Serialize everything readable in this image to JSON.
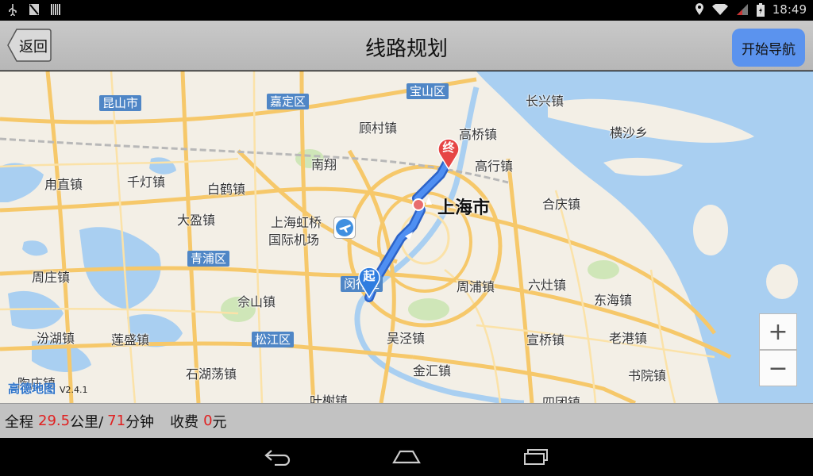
{
  "status_bar": {
    "time": "18:49",
    "icons": [
      "usb-icon",
      "no-sim-icon",
      "barcode-icon",
      "location-icon",
      "wifi-icon",
      "signal-icon",
      "battery-icon"
    ]
  },
  "header": {
    "back_label": "返回",
    "title": "线路规划",
    "start_nav_label": "开始导航"
  },
  "map": {
    "labels": [
      "长兴镇",
      "横沙乡",
      "高桥镇",
      "高行镇",
      "合庆镇",
      "顾村镇",
      "南翔",
      "白鹤镇",
      "千灯镇",
      "甪直镇",
      "大盈镇",
      "周庄镇",
      "佘山镇",
      "汾湖镇",
      "莲盛镇",
      "石湖荡镇",
      "周浦镇",
      "六灶镇",
      "东海镇",
      "宣桥镇",
      "老港镇",
      "书院镇",
      "吴泾镇",
      "金汇镇",
      "叶榭镇",
      "陶庄镇",
      "四团镇"
    ],
    "districts": [
      "昆山市",
      "嘉定区",
      "宝山区",
      "青浦区",
      "闵行区",
      "松江区"
    ],
    "city_label": "上海市",
    "airport_label_line1": "上海虹桥",
    "airport_label_line2": "国际机场",
    "start_marker": "起",
    "end_marker": "终",
    "zoom_in": "+",
    "zoom_out": "−",
    "logo_text": "高德地图",
    "version": "V2.4.1"
  },
  "route_info": {
    "distance_label": "全程",
    "distance_value": "29.5",
    "distance_unit": "公里/",
    "time_value": "71",
    "time_unit": "分钟",
    "toll_label": "收费",
    "toll_value": "0",
    "toll_unit": "元"
  },
  "colors": {
    "route": "#3f7fe8",
    "water": "#a9cff1",
    "road": "#f6c86a",
    "accent_button": "#5b93ee",
    "highlight_text": "#e02020"
  }
}
